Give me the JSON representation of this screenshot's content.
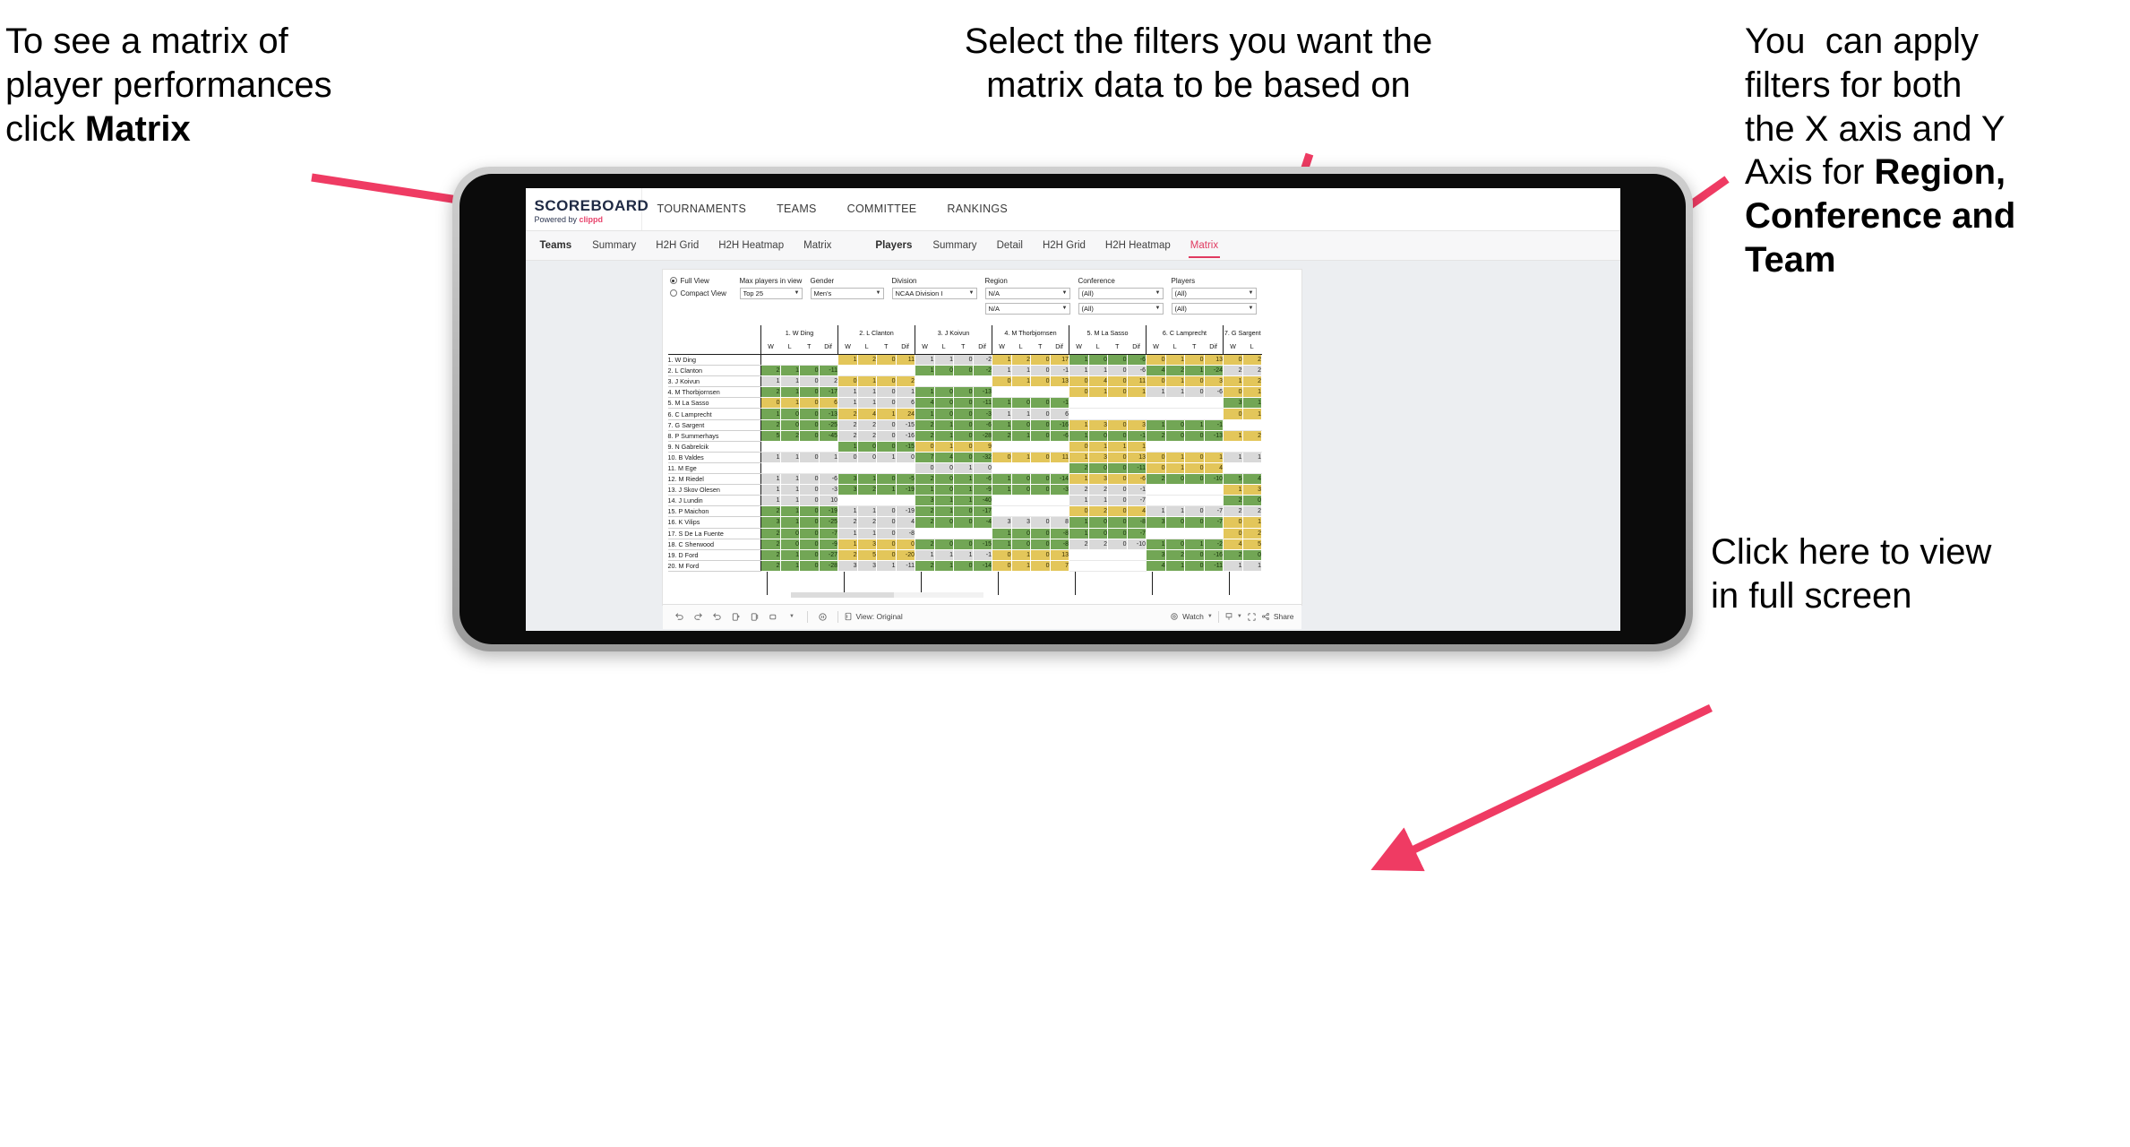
{
  "annotations": {
    "matrix_hint_pre": "To see a matrix of\nplayer performances\nclick ",
    "matrix_hint_bold": "Matrix",
    "filters_hint": "Select the filters you want the\nmatrix data to be based on",
    "axis_hint_pre": "You  can apply\nfilters for both\nthe X axis and Y\nAxis for ",
    "axis_hint_bold": "Region,\nConference and\nTeam",
    "fullscreen_hint": "Click here to view\nin full screen",
    "arrow_color": "#ef3b63"
  },
  "app": {
    "brand": {
      "wordmark": "SCOREBOARD",
      "powered_prefix": "Powered by ",
      "powered_brand": "clippd"
    },
    "top_nav": [
      "TOURNAMENTS",
      "TEAMS",
      "COMMITTEE",
      "RANKINGS"
    ],
    "sub_nav": {
      "group1_lead": "Teams",
      "group1": [
        "Summary",
        "H2H Grid",
        "H2H Heatmap",
        "Matrix"
      ],
      "group2_lead": "Players",
      "group2": [
        "Summary",
        "Detail",
        "H2H Grid",
        "H2H Heatmap",
        "Matrix"
      ],
      "active": "Matrix"
    }
  },
  "filters": {
    "view_full": "Full View",
    "view_compact": "Compact View",
    "view_selected": "Full View",
    "fields": [
      {
        "label": "Max players in view",
        "value": "Top 25"
      },
      {
        "label": "Gender",
        "value": "Men's"
      },
      {
        "label": "Division",
        "value": "NCAA Division I"
      }
    ],
    "axis_fields": [
      {
        "label": "Region",
        "x": "N/A",
        "y": "N/A"
      },
      {
        "label": "Conference",
        "x": "(All)",
        "y": "(All)"
      },
      {
        "label": "Players",
        "x": "(All)",
        "y": "(All)"
      }
    ]
  },
  "toolbar": {
    "icons": [
      "undo-icon",
      "redo-icon",
      "revert-icon",
      "refresh-icon",
      "pause-icon",
      "rect-select-icon"
    ],
    "view_label": "View: Original",
    "watch_label": "Watch",
    "share_label": "Share",
    "download_icon": "download-icon",
    "fullscreen_icon": "fullscreen-icon"
  },
  "chart_data": {
    "type": "table",
    "title": "Player head-to-head performance matrix",
    "subcolumns": [
      "W",
      "L",
      "T",
      "Dif"
    ],
    "columns": [
      "1. W Ding",
      "2. L Clanton",
      "3. J Koivun",
      "4. M Thorbjornsen",
      "5. M La Sasso",
      "6. C Lamprecht",
      "7. G Sargent"
    ],
    "column_7_clipped_subcolumns": [
      "W",
      "L"
    ],
    "rows": [
      "1. W Ding",
      "2. L Clanton",
      "3. J Koivun",
      "4. M Thorbjornsen",
      "5. M La Sasso",
      "6. C Lamprecht",
      "7. G Sargent",
      "8. P Summerhays",
      "9. N Gabrelcik",
      "10. B Valdes",
      "11. M Ege",
      "12. M Riedel",
      "13. J Skov Olesen",
      "14. J Lundin",
      "15. P Maichon",
      "16. K Vilips",
      "17. S De La Fuente",
      "18. C Sherwood",
      "19. D Ford",
      "20. M Ford"
    ],
    "color_key": {
      "g": "#72a655",
      "y": "#e3c65a",
      "n": "#d9d9d9",
      "e": "#ffffff"
    },
    "cells": [
      [
        {
          "v": null,
          "c": "e"
        },
        {
          "v": [
            1,
            2,
            0,
            11
          ],
          "c": "y"
        },
        {
          "v": [
            1,
            1,
            0,
            -2
          ],
          "c": "n"
        },
        {
          "v": [
            1,
            2,
            0,
            17
          ],
          "c": "y"
        },
        {
          "v": [
            1,
            0,
            0,
            -6
          ],
          "c": "g"
        },
        {
          "v": [
            0,
            1,
            0,
            13
          ],
          "c": "y"
        },
        {
          "v": [
            0,
            2
          ],
          "c": "y"
        }
      ],
      [
        {
          "v": [
            2,
            1,
            0,
            -11
          ],
          "c": "g"
        },
        {
          "v": null,
          "c": "e"
        },
        {
          "v": [
            1,
            0,
            0,
            -2
          ],
          "c": "g"
        },
        {
          "v": [
            1,
            1,
            0,
            -1
          ],
          "c": "n"
        },
        {
          "v": [
            1,
            1,
            0,
            -6
          ],
          "c": "n"
        },
        {
          "v": [
            4,
            2,
            1,
            -24
          ],
          "c": "g"
        },
        {
          "v": [
            2,
            2
          ],
          "c": "n"
        }
      ],
      [
        {
          "v": [
            1,
            1,
            0,
            2
          ],
          "c": "n"
        },
        {
          "v": [
            0,
            1,
            0,
            2
          ],
          "c": "y"
        },
        {
          "v": null,
          "c": "e"
        },
        {
          "v": [
            0,
            1,
            0,
            13
          ],
          "c": "y"
        },
        {
          "v": [
            0,
            4,
            0,
            11
          ],
          "c": "y"
        },
        {
          "v": [
            0,
            1,
            0,
            3
          ],
          "c": "y"
        },
        {
          "v": [
            1,
            2
          ],
          "c": "y"
        }
      ],
      [
        {
          "v": [
            2,
            1,
            0,
            -17
          ],
          "c": "g"
        },
        {
          "v": [
            1,
            1,
            0,
            1
          ],
          "c": "n"
        },
        {
          "v": [
            1,
            0,
            0,
            -13
          ],
          "c": "g"
        },
        {
          "v": null,
          "c": "e"
        },
        {
          "v": [
            0,
            1,
            0,
            1
          ],
          "c": "y"
        },
        {
          "v": [
            1,
            1,
            0,
            -6
          ],
          "c": "n"
        },
        {
          "v": [
            0,
            1
          ],
          "c": "y"
        }
      ],
      [
        {
          "v": [
            0,
            1,
            0,
            6
          ],
          "c": "y"
        },
        {
          "v": [
            1,
            1,
            0,
            6
          ],
          "c": "n"
        },
        {
          "v": [
            4,
            0,
            0,
            -11
          ],
          "c": "g"
        },
        {
          "v": [
            1,
            0,
            0,
            -1
          ],
          "c": "g"
        },
        {
          "v": null,
          "c": "e"
        },
        {
          "v": null,
          "c": "e"
        },
        {
          "v": [
            3,
            1
          ],
          "c": "g"
        }
      ],
      [
        {
          "v": [
            1,
            0,
            0,
            -13
          ],
          "c": "g"
        },
        {
          "v": [
            2,
            4,
            1,
            24
          ],
          "c": "y"
        },
        {
          "v": [
            1,
            0,
            0,
            -3
          ],
          "c": "g"
        },
        {
          "v": [
            1,
            1,
            0,
            6
          ],
          "c": "n"
        },
        {
          "v": null,
          "c": "e"
        },
        {
          "v": null,
          "c": "e"
        },
        {
          "v": [
            0,
            1
          ],
          "c": "y"
        }
      ],
      [
        {
          "v": [
            2,
            0,
            0,
            -25
          ],
          "c": "g"
        },
        {
          "v": [
            2,
            2,
            0,
            -15
          ],
          "c": "n"
        },
        {
          "v": [
            2,
            1,
            0,
            -6
          ],
          "c": "g"
        },
        {
          "v": [
            1,
            0,
            0,
            -16
          ],
          "c": "g"
        },
        {
          "v": [
            1,
            3,
            0,
            3
          ],
          "c": "y"
        },
        {
          "v": [
            1,
            0,
            1,
            -1
          ],
          "c": "g"
        },
        {
          "v": null,
          "c": "e"
        }
      ],
      [
        {
          "v": [
            5,
            2,
            0,
            -45
          ],
          "c": "g"
        },
        {
          "v": [
            2,
            2,
            0,
            -16
          ],
          "c": "n"
        },
        {
          "v": [
            2,
            1,
            0,
            -28
          ],
          "c": "g"
        },
        {
          "v": [
            2,
            1,
            0,
            -6
          ],
          "c": "g"
        },
        {
          "v": [
            1,
            0,
            0,
            -1
          ],
          "c": "g"
        },
        {
          "v": [
            2,
            0,
            0,
            -13
          ],
          "c": "g"
        },
        {
          "v": [
            1,
            2
          ],
          "c": "y"
        }
      ],
      [
        {
          "v": null,
          "c": "e"
        },
        {
          "v": [
            1,
            0,
            0,
            -15
          ],
          "c": "g"
        },
        {
          "v": [
            0,
            1,
            0,
            9
          ],
          "c": "y"
        },
        {
          "v": null,
          "c": "e"
        },
        {
          "v": [
            0,
            1,
            1,
            1
          ],
          "c": "y"
        },
        {
          "v": null,
          "c": "e"
        },
        {
          "v": null,
          "c": "e"
        }
      ],
      [
        {
          "v": [
            1,
            1,
            0,
            1
          ],
          "c": "n"
        },
        {
          "v": [
            0,
            0,
            1,
            0
          ],
          "c": "n"
        },
        {
          "v": [
            7,
            4,
            0,
            -32
          ],
          "c": "g"
        },
        {
          "v": [
            0,
            1,
            0,
            11
          ],
          "c": "y"
        },
        {
          "v": [
            1,
            3,
            0,
            13
          ],
          "c": "y"
        },
        {
          "v": [
            0,
            1,
            0,
            1
          ],
          "c": "y"
        },
        {
          "v": [
            1,
            1
          ],
          "c": "n"
        }
      ],
      [
        {
          "v": null,
          "c": "e"
        },
        {
          "v": null,
          "c": "e"
        },
        {
          "v": [
            0,
            0,
            1,
            0
          ],
          "c": "n"
        },
        {
          "v": null,
          "c": "e"
        },
        {
          "v": [
            2,
            0,
            0,
            -11
          ],
          "c": "g"
        },
        {
          "v": [
            0,
            1,
            0,
            4
          ],
          "c": "y"
        },
        {
          "v": null,
          "c": "e"
        }
      ],
      [
        {
          "v": [
            1,
            1,
            0,
            -6
          ],
          "c": "n"
        },
        {
          "v": [
            3,
            1,
            0,
            -5
          ],
          "c": "g"
        },
        {
          "v": [
            2,
            0,
            1,
            -6
          ],
          "c": "g"
        },
        {
          "v": [
            1,
            0,
            0,
            -14
          ],
          "c": "g"
        },
        {
          "v": [
            1,
            3,
            0,
            -6
          ],
          "c": "y"
        },
        {
          "v": [
            2,
            0,
            0,
            -10
          ],
          "c": "g"
        },
        {
          "v": [
            5,
            4
          ],
          "c": "g"
        }
      ],
      [
        {
          "v": [
            1,
            1,
            0,
            -3
          ],
          "c": "n"
        },
        {
          "v": [
            3,
            2,
            1,
            -19
          ],
          "c": "g"
        },
        {
          "v": [
            1,
            0,
            1,
            -9
          ],
          "c": "g"
        },
        {
          "v": [
            1,
            0,
            0,
            -3
          ],
          "c": "g"
        },
        {
          "v": [
            2,
            2,
            0,
            -1
          ],
          "c": "n"
        },
        {
          "v": null,
          "c": "e"
        },
        {
          "v": [
            1,
            3
          ],
          "c": "y"
        }
      ],
      [
        {
          "v": [
            1,
            1,
            0,
            10
          ],
          "c": "n"
        },
        {
          "v": null,
          "c": "e"
        },
        {
          "v": [
            3,
            1,
            1,
            -40
          ],
          "c": "g"
        },
        {
          "v": null,
          "c": "e"
        },
        {
          "v": [
            1,
            1,
            0,
            -7
          ],
          "c": "n"
        },
        {
          "v": null,
          "c": "e"
        },
        {
          "v": [
            2,
            0
          ],
          "c": "g"
        }
      ],
      [
        {
          "v": [
            2,
            1,
            0,
            -19
          ],
          "c": "g"
        },
        {
          "v": [
            1,
            1,
            0,
            -19
          ],
          "c": "n"
        },
        {
          "v": [
            2,
            1,
            0,
            -17
          ],
          "c": "g"
        },
        {
          "v": null,
          "c": "e"
        },
        {
          "v": [
            0,
            2,
            0,
            4
          ],
          "c": "y"
        },
        {
          "v": [
            1,
            1,
            0,
            -7
          ],
          "c": "n"
        },
        {
          "v": [
            2,
            2
          ],
          "c": "n"
        }
      ],
      [
        {
          "v": [
            3,
            1,
            0,
            -25
          ],
          "c": "g"
        },
        {
          "v": [
            2,
            2,
            0,
            4
          ],
          "c": "n"
        },
        {
          "v": [
            2,
            0,
            0,
            -4
          ],
          "c": "g"
        },
        {
          "v": [
            3,
            3,
            0,
            8
          ],
          "c": "n"
        },
        {
          "v": [
            1,
            0,
            0,
            -8
          ],
          "c": "g"
        },
        {
          "v": [
            3,
            0,
            0,
            -7
          ],
          "c": "g"
        },
        {
          "v": [
            0,
            1
          ],
          "c": "y"
        }
      ],
      [
        {
          "v": [
            2,
            0,
            0,
            -7
          ],
          "c": "g"
        },
        {
          "v": [
            1,
            1,
            0,
            -8
          ],
          "c": "n"
        },
        {
          "v": null,
          "c": "e"
        },
        {
          "v": [
            1,
            0,
            0,
            -8
          ],
          "c": "g"
        },
        {
          "v": [
            1,
            0,
            0,
            -7
          ],
          "c": "g"
        },
        {
          "v": null,
          "c": "e"
        },
        {
          "v": [
            0,
            2
          ],
          "c": "y"
        }
      ],
      [
        {
          "v": [
            2,
            0,
            0,
            -9
          ],
          "c": "g"
        },
        {
          "v": [
            1,
            3,
            0,
            0
          ],
          "c": "y"
        },
        {
          "v": [
            2,
            0,
            0,
            -15
          ],
          "c": "g"
        },
        {
          "v": [
            1,
            0,
            0,
            -8
          ],
          "c": "g"
        },
        {
          "v": [
            2,
            2,
            0,
            -10
          ],
          "c": "n"
        },
        {
          "v": [
            1,
            0,
            1,
            -2
          ],
          "c": "g"
        },
        {
          "v": [
            4,
            5
          ],
          "c": "y"
        }
      ],
      [
        {
          "v": [
            2,
            1,
            0,
            -27
          ],
          "c": "g"
        },
        {
          "v": [
            2,
            5,
            0,
            -20
          ],
          "c": "y"
        },
        {
          "v": [
            1,
            1,
            1,
            -1
          ],
          "c": "n"
        },
        {
          "v": [
            0,
            1,
            0,
            13
          ],
          "c": "y"
        },
        {
          "v": null,
          "c": "e"
        },
        {
          "v": [
            3,
            2,
            0,
            -16
          ],
          "c": "g"
        },
        {
          "v": [
            2,
            0
          ],
          "c": "g"
        }
      ],
      [
        {
          "v": [
            2,
            1,
            0,
            -28
          ],
          "c": "g"
        },
        {
          "v": [
            3,
            3,
            1,
            -11
          ],
          "c": "n"
        },
        {
          "v": [
            2,
            1,
            0,
            -14
          ],
          "c": "g"
        },
        {
          "v": [
            0,
            1,
            0,
            7
          ],
          "c": "y"
        },
        {
          "v": null,
          "c": "e"
        },
        {
          "v": [
            4,
            1,
            0,
            -11
          ],
          "c": "g"
        },
        {
          "v": [
            1,
            1
          ],
          "c": "n"
        }
      ]
    ]
  }
}
